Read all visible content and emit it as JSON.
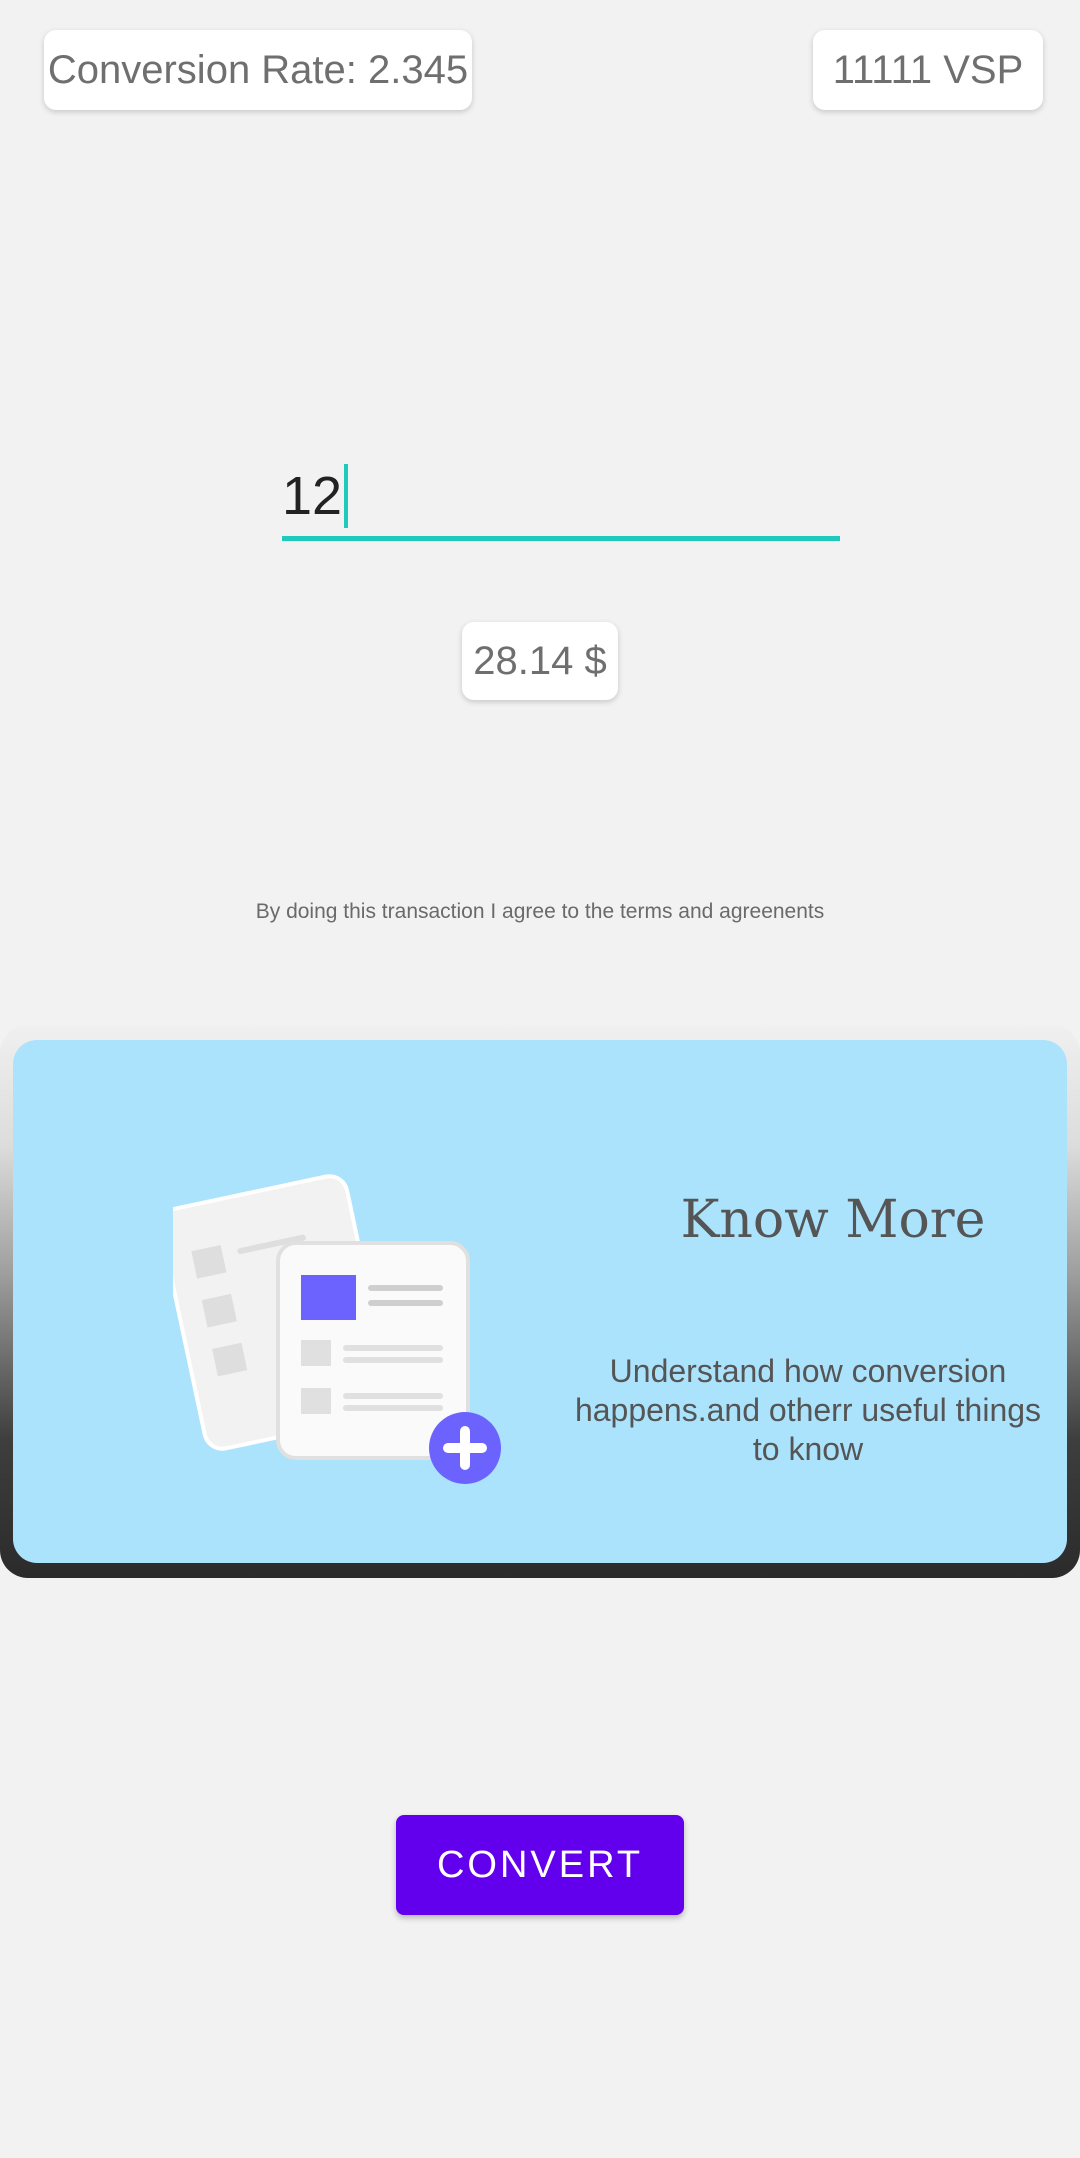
{
  "header": {
    "conversion_rate": "Conversion Rate: 2.345",
    "balance": "11111 VSP"
  },
  "converter": {
    "amount_value": "12",
    "result": "28.14 $"
  },
  "terms_text": "By doing this transaction I agree to the terms and agreenents",
  "info_card": {
    "title": "Know More",
    "description": "Understand how conversion happens.and otherr useful things to know",
    "icon": "documents-add-illustration"
  },
  "actions": {
    "convert_label": "CONVERT"
  },
  "colors": {
    "accent": "#1fc9bb",
    "primary": "#6200ee",
    "card_background": "#abe3fc",
    "illustration_accent": "#6c63ff"
  }
}
